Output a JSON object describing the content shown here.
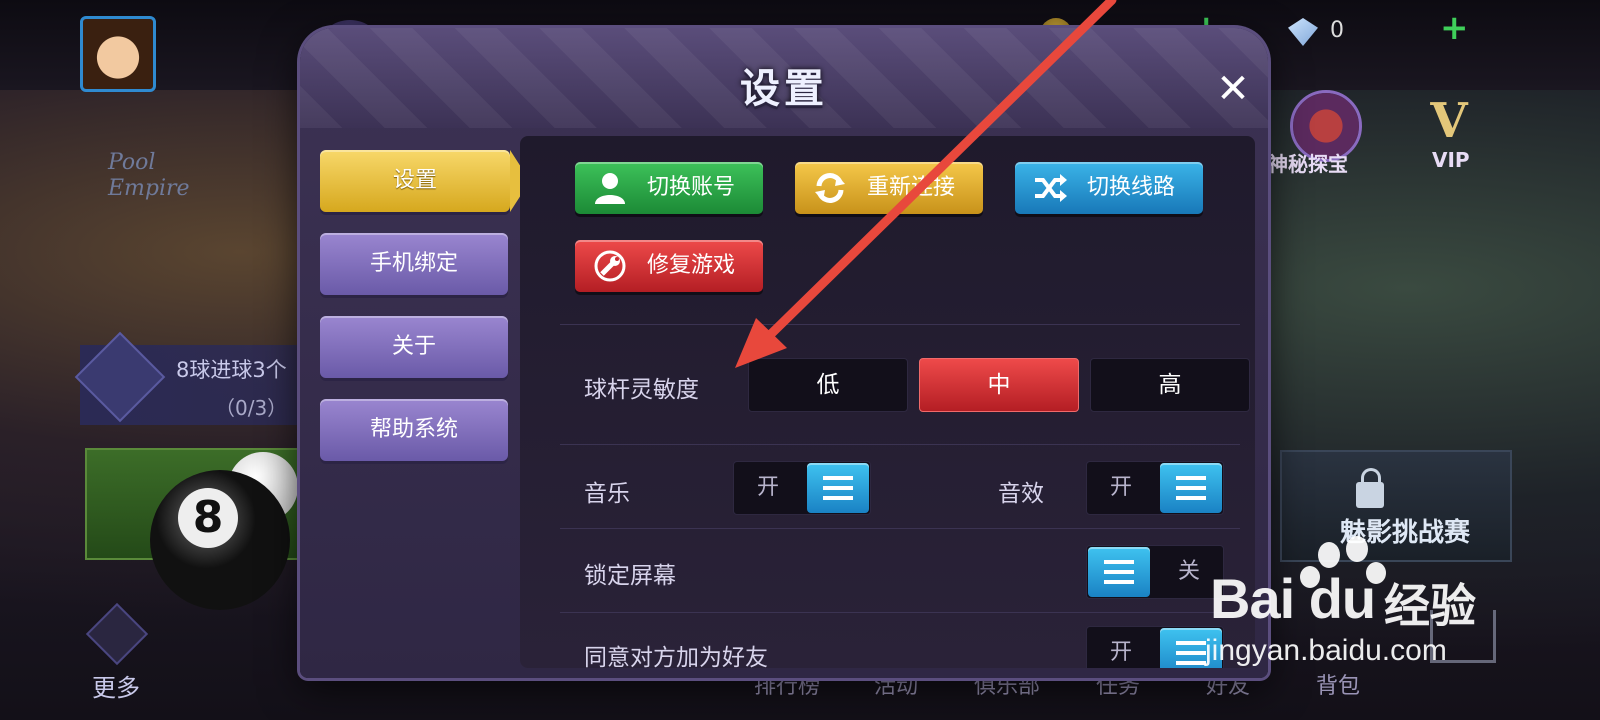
{
  "lobby": {
    "gem_count": "0",
    "treasure_label": "神秘探宝",
    "vip_label": "VIP",
    "vip_glyph": "V",
    "pool_sign": "Pool Empire",
    "task_text": "8球进球3个",
    "task_progress": "（0/3）",
    "ball_number": "8",
    "right_card_title": "魅影挑战赛",
    "more_label": "更多",
    "bottom_nav": [
      "排行榜",
      "活动",
      "俱乐部",
      "任务",
      "好友",
      "背包"
    ]
  },
  "dialog": {
    "title": "设置",
    "close_glyph": "✕",
    "side_tabs": [
      {
        "label": "设置",
        "active": true
      },
      {
        "label": "手机绑定",
        "active": false
      },
      {
        "label": "关于",
        "active": false
      },
      {
        "label": "帮助系统",
        "active": false
      }
    ],
    "actions": [
      {
        "label": "切换账号",
        "icon": "user-icon",
        "color": "#2ea84a"
      },
      {
        "label": "重新连接",
        "icon": "refresh-icon",
        "color": "#e0ae2e"
      },
      {
        "label": "切换线路",
        "icon": "shuffle-icon",
        "color": "#2a98d4"
      },
      {
        "label": "修复游戏",
        "icon": "wrench-icon",
        "color": "#d8343a"
      }
    ],
    "sensitivity": {
      "label": "球杆灵敏度",
      "options": [
        "低",
        "中",
        "高"
      ],
      "selected": "中"
    },
    "music": {
      "label": "音乐",
      "state_text": "开",
      "on": true
    },
    "sfx": {
      "label": "音效",
      "state_text": "开",
      "on": true
    },
    "lock_screen": {
      "label": "锁定屏幕",
      "state_text": "关",
      "on": false
    },
    "accept_friend": {
      "label": "同意对方加为好友",
      "state_text": "开",
      "on": true
    }
  },
  "watermark": {
    "brand": "Bai du",
    "brand_cn": "经验",
    "url": "jingyan.baidu.com"
  },
  "colors": {
    "accent_gold": "#e7bf3e",
    "accent_red": "#d8343a",
    "toggle_blue": "#2a98d4",
    "annotation_arrow": "#e8483c"
  }
}
